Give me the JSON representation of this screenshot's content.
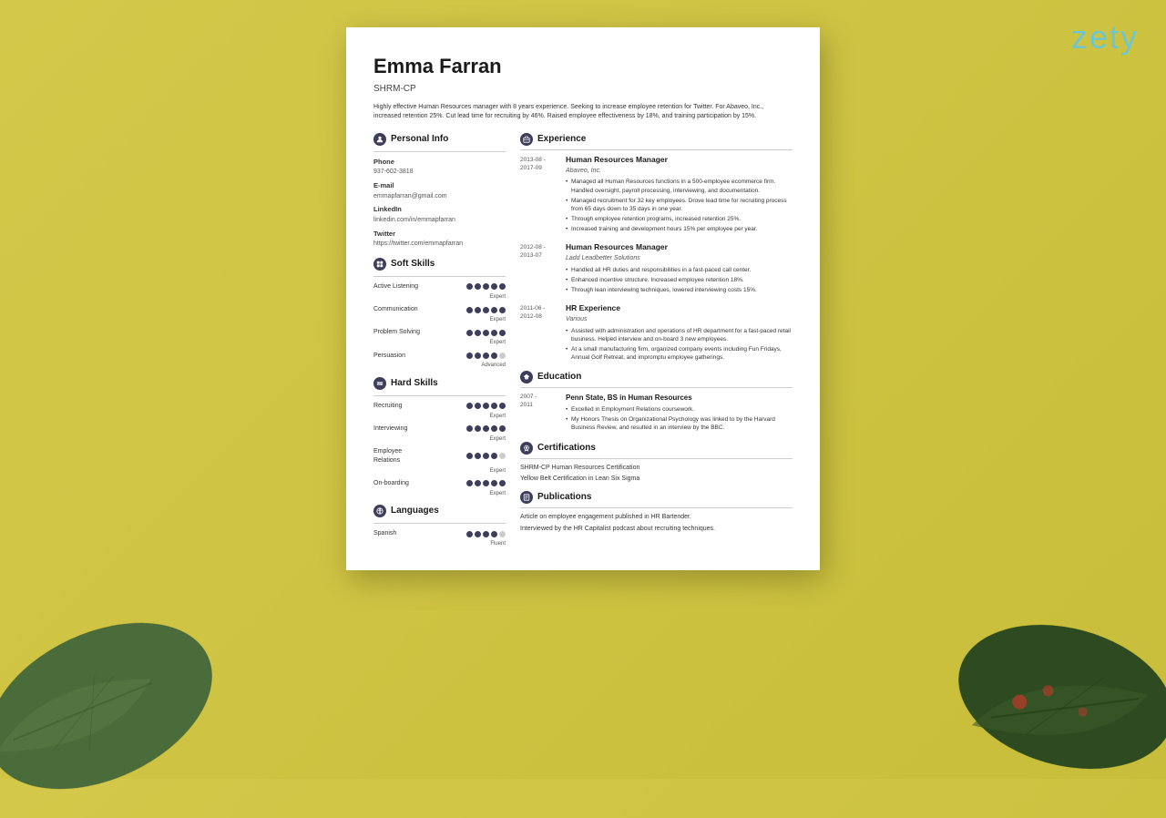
{
  "logo": "zety",
  "resume": {
    "name": "Emma Farran",
    "title": "SHRM-CP",
    "summary": "Highly effective Human Resources manager with 8 years experience. Seeking to increase employee retention for Twitter. For Abaveo, Inc., increased retention 25%. Cut lead time for recruiting by 46%. Raised employee effectiveness by 18%, and training participation by 15%.",
    "personal_info": {
      "section_title": "Personal Info",
      "phone_label": "Phone",
      "phone": "937-602-3818",
      "email_label": "E-mail",
      "email": "emmapfarran@gmail.com",
      "linkedin_label": "LinkedIn",
      "linkedin": "linkedin.com/in/emmapfarran",
      "twitter_label": "Twitter",
      "twitter": "https://twitter.com/emmapfarran"
    },
    "soft_skills": {
      "section_title": "Soft Skills",
      "items": [
        {
          "name": "Active Listening",
          "dots": 5,
          "level": "Expert"
        },
        {
          "name": "Communication",
          "dots": 5,
          "level": "Expert"
        },
        {
          "name": "Problem Solving",
          "dots": 5,
          "level": "Expert"
        },
        {
          "name": "Persuasion",
          "dots": 4,
          "level": "Advanced"
        }
      ]
    },
    "hard_skills": {
      "section_title": "Hard Skills",
      "items": [
        {
          "name": "Recruiting",
          "dots": 5,
          "level": "Expert"
        },
        {
          "name": "Interviewing",
          "dots": 5,
          "level": "Expert"
        },
        {
          "name": "Employee Relations",
          "dots": 4,
          "level": "Expert"
        },
        {
          "name": "On-boarding",
          "dots": 5,
          "level": "Expert"
        }
      ]
    },
    "languages": {
      "section_title": "Languages",
      "items": [
        {
          "name": "Spanish",
          "dots": 4,
          "level": "Fluent"
        }
      ]
    },
    "experience": {
      "section_title": "Experience",
      "items": [
        {
          "date": "2013-08 -\n2017-09",
          "job_title": "Human Resources Manager",
          "company": "Abaveo, Inc.",
          "bullets": [
            "Managed all Human Resources functions in a 500-employee ecommerce firm. Handled oversight, payroll processing, interviewing, and documentation.",
            "Managed recruitment for 32 key employees. Drove lead time for recruiting process from 65 days down to 35 days in one year.",
            "Through employee retention programs, increased retention 25%.",
            "Increased training and development hours 15% per employee per year."
          ]
        },
        {
          "date": "2012-08 -\n2013-07",
          "job_title": "Human Resources Manager",
          "company": "Ladd Leadbetter Solutions",
          "bullets": [
            "Handled all HR duties and responsibilities in a fast-paced call center.",
            "Enhanced incentive structure. Increased employee retention 18%.",
            "Through lean interviewing techniques, lowered interviewing costs 15%."
          ]
        },
        {
          "date": "2011-06 -\n2012-08",
          "job_title": "HR Experience",
          "company": "Various",
          "bullets": [
            "Assisted with administration and operations of HR department for a fast-paced retail business. Helped interview and on-board 3 new employees.",
            "At a small manufacturing firm, organized company events including Fun Fridays, Annual Golf Retreat, and impromptu employee gatherings."
          ]
        }
      ]
    },
    "education": {
      "section_title": "Education",
      "items": [
        {
          "date": "2007 -\n2011",
          "degree": "Penn State, BS in Human Resources",
          "bullets": [
            "Excelled in Employment Relations coursework.",
            "My Honors Thesis on Organizational Psychology was linked to by the Harvard Business Review, and resulted in an interview by the BBC."
          ]
        }
      ]
    },
    "certifications": {
      "section_title": "Certifications",
      "items": [
        "SHRM-CP Human Resources Certification",
        "Yellow Belt Certification in Lean Six Sigma"
      ]
    },
    "publications": {
      "section_title": "Publications",
      "items": [
        "Article on employee engagement published in HR Bartender.",
        "Interviewed by the HR Capitalist podcast about recruiting techniques."
      ]
    }
  }
}
